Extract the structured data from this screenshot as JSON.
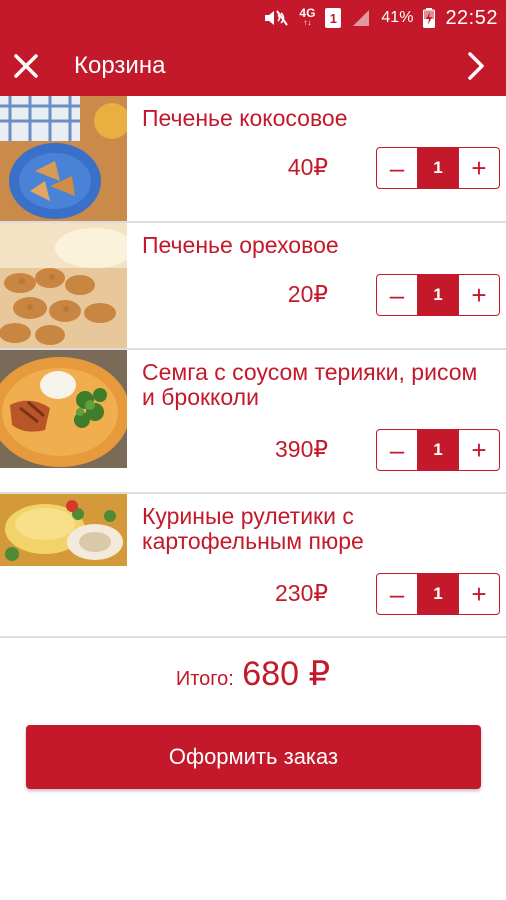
{
  "status_bar": {
    "network": "4G",
    "network_sub": "↑↓",
    "sim_number": "1",
    "battery": "41%",
    "time": "22:52"
  },
  "app_bar": {
    "title": "Корзина",
    "close_icon": "close-icon",
    "next_icon": "chevron-right-icon"
  },
  "colors": {
    "accent": "#c3192a",
    "divider": "#dcdcdc"
  },
  "cart": {
    "items": [
      {
        "name": "Печенье кокосовое",
        "price": "40₽",
        "quantity": "1",
        "image": "coconut-cookies-photo"
      },
      {
        "name": "Печенье ореховое",
        "price": "20₽",
        "quantity": "1",
        "image": "nut-cookies-photo"
      },
      {
        "name": "Семга с соусом терияки, рисом и брокколи",
        "price": "390₽",
        "quantity": "1",
        "image": "salmon-teriyaki-photo"
      },
      {
        "name": "Куриные рулетики с картофельным пюре",
        "price": "230₽",
        "quantity": "1",
        "image": "chicken-rolls-photo"
      }
    ],
    "minus_label": "–",
    "plus_label": "+"
  },
  "total": {
    "label": "Итого:",
    "amount": "680 ₽"
  },
  "checkout": {
    "label": "Оформить заказ"
  }
}
